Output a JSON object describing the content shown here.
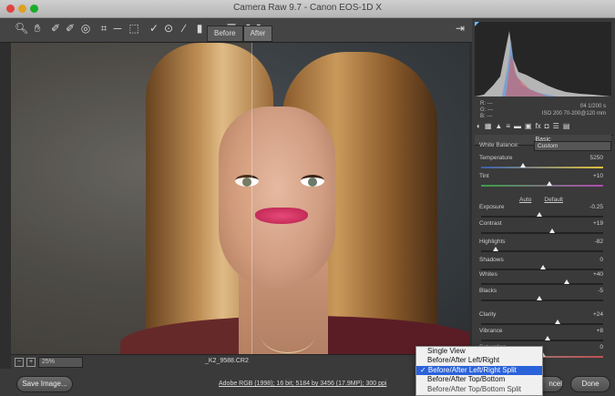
{
  "window": {
    "title": "Camera Raw 9.7  -  Canon EOS-1D X"
  },
  "toolbar": {
    "tools": [
      "zoom-icon",
      "hand-icon",
      "white-balance-icon",
      "color-sampler-icon",
      "targeted-adjustment-icon",
      "crop-icon",
      "straighten-icon",
      "transform-icon",
      "spot-removal-icon",
      "red-eye-icon",
      "adjustment-brush-icon",
      "graduated-filter-icon",
      "radial-filter-icon",
      "preferences-icon",
      "rotate-ccw-icon",
      "rotate-cw-icon"
    ],
    "export_icon": "open-icon"
  },
  "view_toggle": {
    "before": "Before",
    "after": "After"
  },
  "preview": {
    "zoom": "25%",
    "filename": "_K2_9588.CR2"
  },
  "footer": {
    "save": "Save Image...",
    "workflow": "Adobe RGB (1998); 16 bit; 5184 by 3456 (17.9MP); 300 ppi",
    "cancel": "ncel",
    "done": "Done"
  },
  "readout": {
    "r": "R:   ---",
    "g": "G:   ---",
    "b": "B:   ---",
    "exposure": "f/4   1/200 s",
    "iso": "ISO 200   70-200@120 mm"
  },
  "panel": {
    "title": "Basic",
    "white_balance_label": "White Balance:",
    "white_balance_value": "Custom",
    "auto": "Auto",
    "default": "Default",
    "sliders": [
      {
        "label": "Temperature",
        "value": "5250",
        "pos": 0.33,
        "track": "temp"
      },
      {
        "label": "Tint",
        "value": "+10",
        "pos": 0.55,
        "track": "tint"
      },
      {
        "label": "Exposure",
        "value": "-0.25",
        "pos": 0.47,
        "track": ""
      },
      {
        "label": "Contrast",
        "value": "+19",
        "pos": 0.58,
        "track": ""
      },
      {
        "label": "Highlights",
        "value": "-82",
        "pos": 0.1,
        "track": ""
      },
      {
        "label": "Shadows",
        "value": "0",
        "pos": 0.5,
        "track": ""
      },
      {
        "label": "Whites",
        "value": "+40",
        "pos": 0.7,
        "track": ""
      },
      {
        "label": "Blacks",
        "value": "-5",
        "pos": 0.47,
        "track": ""
      },
      {
        "label": "Clarity",
        "value": "+24",
        "pos": 0.62,
        "track": ""
      },
      {
        "label": "Vibrance",
        "value": "+8",
        "pos": 0.54,
        "track": ""
      },
      {
        "label": "Saturation",
        "value": "0",
        "pos": 0.5,
        "track": "sat"
      }
    ]
  },
  "menu": {
    "items": [
      {
        "label": "Single View",
        "selected": false
      },
      {
        "label": "Before/After Left/Right",
        "selected": false
      },
      {
        "label": "✓ Before/After Left/Right Split",
        "selected": true
      },
      {
        "label": "Before/After Top/Bottom",
        "selected": false
      },
      {
        "label": "Before/After Top/Bottom Split",
        "selected": false
      }
    ]
  }
}
